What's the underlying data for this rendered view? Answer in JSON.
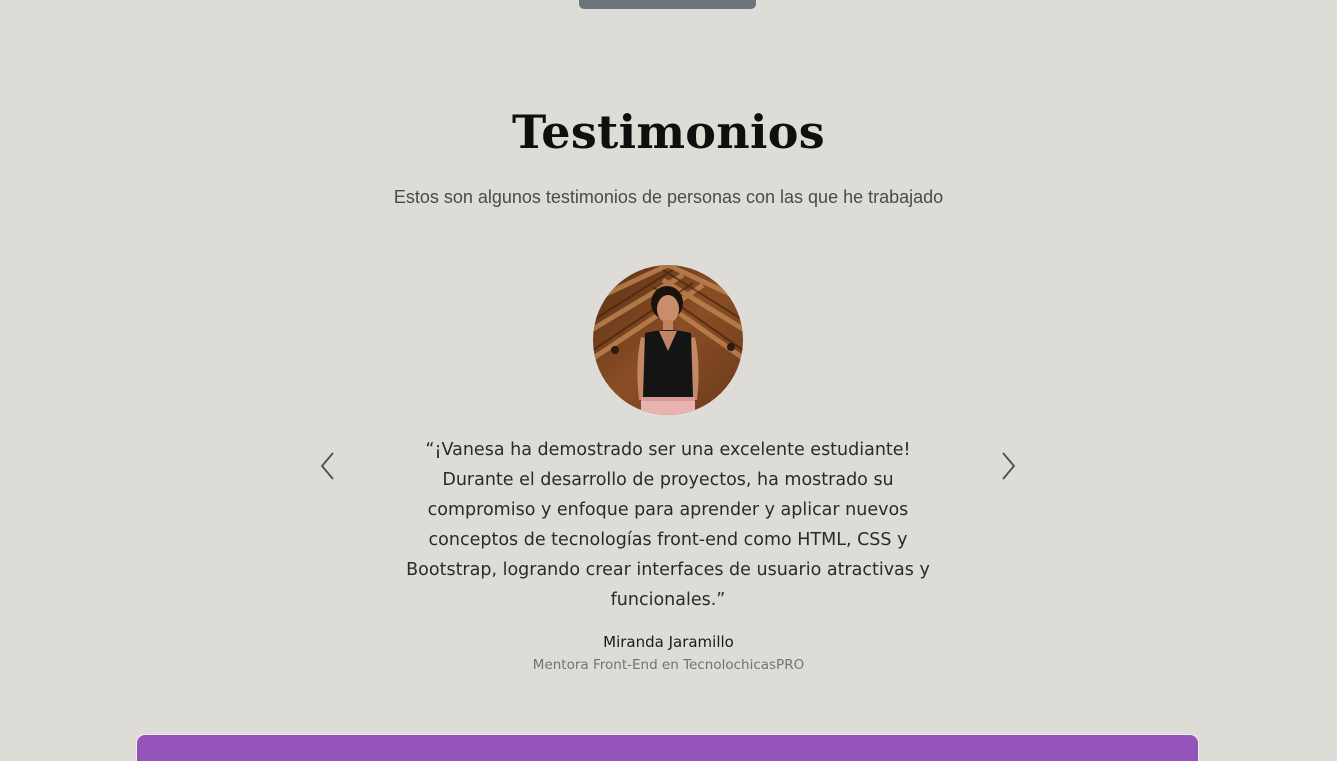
{
  "section": {
    "title": "Testimonios",
    "subtitle": "Estos son algunos testimonios de personas con las que he trabajado"
  },
  "testimonial": {
    "quote": "“¡Vanesa ha demostrado ser una excelente estudiante! Durante el desarrollo de proyectos, ha mostrado su compromiso y enfoque para aprender y aplicar nuevos conceptos de tecnologías front-end como HTML, CSS y Bootstrap, logrando crear interfaces de usuario atractivas y funcionales.”",
    "author": "Miranda Jaramillo",
    "role": "Mentora Front-End en TecnolochicasPRO",
    "photo_icon": "person-photo"
  },
  "carousel": {
    "prev_icon": "chevron-left-icon",
    "next_icon": "chevron-right-icon"
  },
  "colors": {
    "background": "#dddcd6",
    "accent": "#9554b9",
    "top_tab": "#6d747b"
  }
}
